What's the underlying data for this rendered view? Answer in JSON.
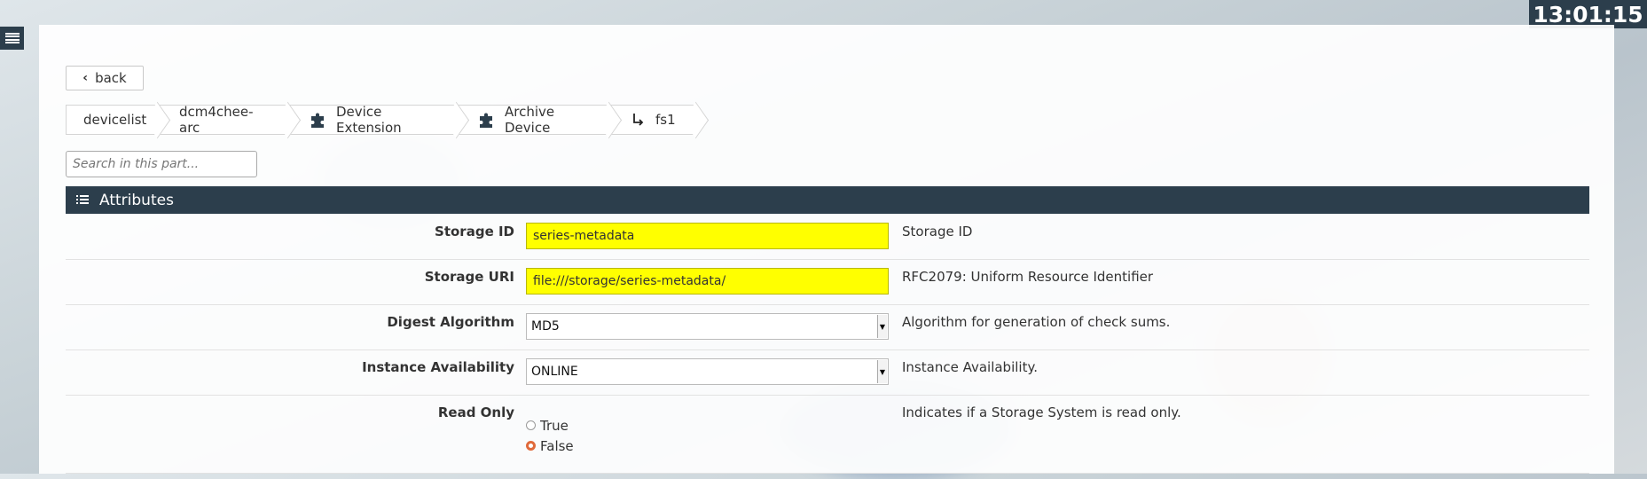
{
  "clock": {
    "time": "13:01:15"
  },
  "nav": {
    "back_label": "back"
  },
  "breadcrumb": {
    "items": [
      {
        "label": "devicelist",
        "icon": ""
      },
      {
        "label": "dcm4chee-arc",
        "icon": ""
      },
      {
        "label": "Device Extension",
        "icon": "puzzle-icon"
      },
      {
        "label": "Archive Device",
        "icon": "puzzle-icon"
      },
      {
        "label": "fs1",
        "icon": "arrow-down-right-icon"
      }
    ]
  },
  "search": {
    "placeholder": "Search in this part..."
  },
  "attributes": {
    "header": "Attributes",
    "storage_id": {
      "label": "Storage ID",
      "value": "series-metadata",
      "description": "Storage ID"
    },
    "storage_uri": {
      "label": "Storage URI",
      "value": "file:///storage/series-metadata/",
      "description": "RFC2079: Uniform Resource Identifier"
    },
    "digest_algorithm": {
      "label": "Digest Algorithm",
      "value": "MD5",
      "description": "Algorithm for generation of check sums."
    },
    "instance_availability": {
      "label": "Instance Availability",
      "value": "ONLINE",
      "description": "Instance Availability."
    },
    "read_only": {
      "label": "Read Only",
      "options": [
        "True",
        "False"
      ],
      "selected": "False",
      "description": "Indicates if a Storage System is read only."
    }
  },
  "colors": {
    "header_bg": "#2c3e4c",
    "required_field": "#ffff00",
    "radio_accent": "#e06a3b"
  }
}
